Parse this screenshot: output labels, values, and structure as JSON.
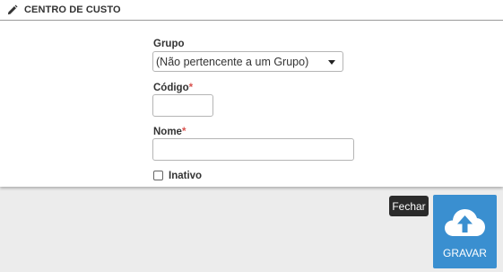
{
  "header": {
    "icon": "pencil-icon",
    "title": "CENTRO DE CUSTO"
  },
  "form": {
    "grupo": {
      "label": "Grupo",
      "selected": "(Não pertencente a um Grupo)"
    },
    "codigo": {
      "label": "Código",
      "required_mark": "*",
      "value": ""
    },
    "nome": {
      "label": "Nome",
      "required_mark": "*",
      "value": ""
    },
    "inativo": {
      "label": "Inativo",
      "checked": false
    }
  },
  "actions": {
    "fechar_label": "Fechar",
    "gravar_label": "GRAVAR",
    "gravar_icon": "cloud-upload-icon"
  },
  "colors": {
    "primary": "#3a8fd0",
    "dark_button": "#2b2b2b",
    "required": "#d9534f",
    "background": "#ececec"
  }
}
